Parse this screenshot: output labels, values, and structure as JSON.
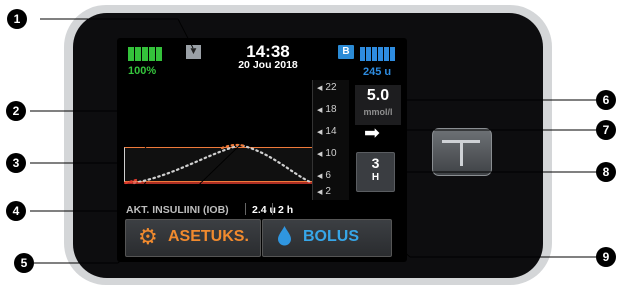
{
  "status_bar": {
    "battery_percent": "100%",
    "transmitter_icon": "antenna-icon",
    "time": "14:38",
    "date": "20 Jou 2018",
    "bluetooth_badge": "B",
    "reservoir_units": "245 u"
  },
  "graph": {
    "scale_ticks": [
      "22",
      "18",
      "14",
      "10",
      "6",
      "2"
    ]
  },
  "glucose": {
    "value": "5.0",
    "units": "mmol/l",
    "trend_icon": "arrow-right-icon",
    "trend_glyph": "➡"
  },
  "graph_hours": {
    "value": "3",
    "unit": "H"
  },
  "iob": {
    "label": "AKT. INSULIINI (IOB)",
    "value": "2.4 u",
    "time": "2 h"
  },
  "buttons": {
    "settings_label": "ASETUKS.",
    "bolus_label": "BOLUS"
  },
  "callouts": [
    "1",
    "2",
    "3",
    "4",
    "5",
    "6",
    "7",
    "8",
    "9"
  ],
  "colors": {
    "battery": "#34c23b",
    "reservoir": "#2e8ce0",
    "target_range": "#f07a3a",
    "settings_accent": "#f18a2e",
    "bolus_accent": "#37a6e8",
    "low_trace": "#e53c2f"
  }
}
